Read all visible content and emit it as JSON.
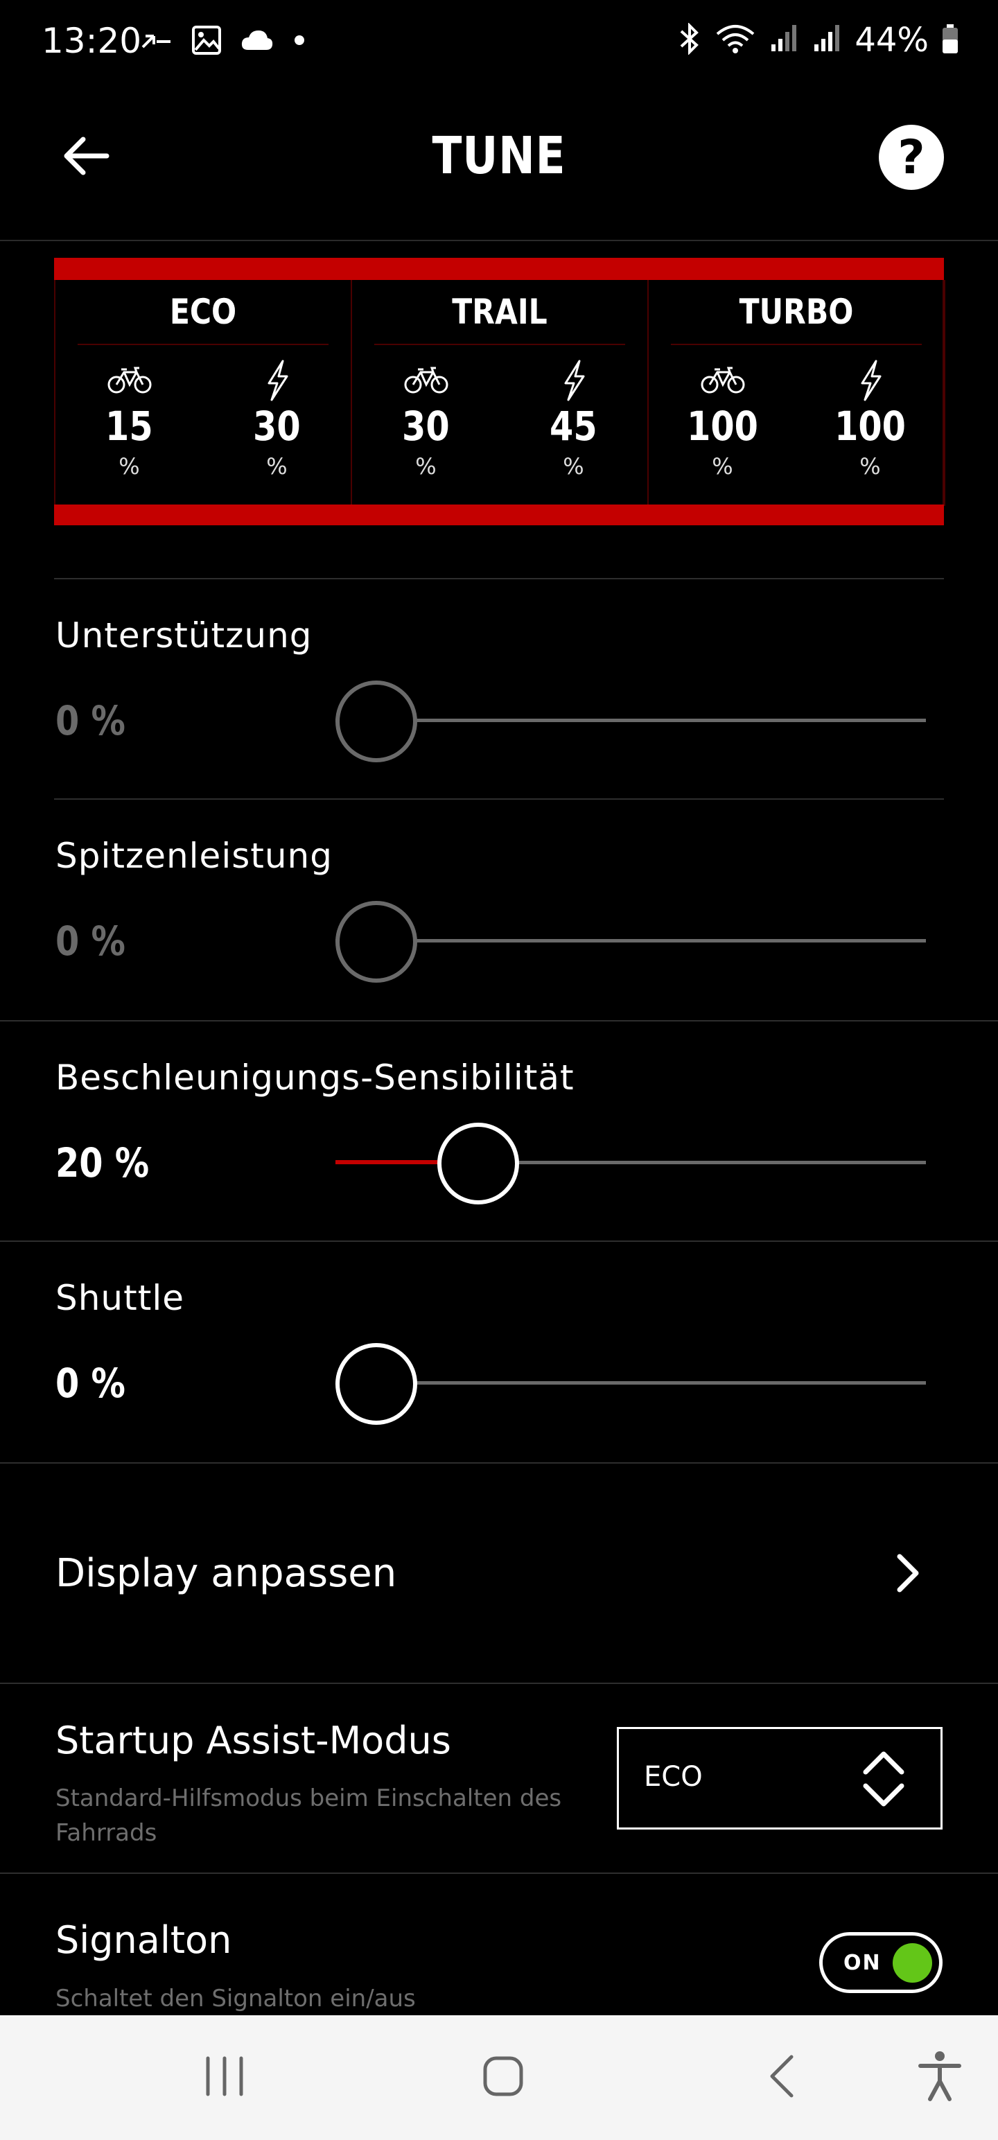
{
  "status_bar": {
    "time": "13:20",
    "battery": "44%",
    "icons_left": [
      "missed-call-icon",
      "gallery-icon",
      "cloud-icon",
      "dot-icon"
    ],
    "icons_right": [
      "bluetooth-icon",
      "wifi-icon",
      "signal-icon",
      "signal-icon",
      "battery-icon"
    ]
  },
  "header": {
    "title": "TUNE",
    "back_icon": "arrow-left-icon",
    "help_label": "?"
  },
  "modes": [
    {
      "name": "ECO",
      "assist": "15",
      "peak": "30",
      "unit": "%"
    },
    {
      "name": "TRAIL",
      "assist": "30",
      "peak": "45",
      "unit": "%"
    },
    {
      "name": "TURBO",
      "assist": "100",
      "peak": "100",
      "unit": "%"
    }
  ],
  "sliders": [
    {
      "label": "Unterstützung",
      "value": "0 %",
      "percent": 0,
      "enabled": false
    },
    {
      "label": "Spitzenleistung",
      "value": "0 %",
      "percent": 0,
      "enabled": false
    },
    {
      "label": "Beschleunigungs-Sensibilität",
      "value": "20 %",
      "percent": 20,
      "enabled": true
    },
    {
      "label": "Shuttle",
      "value": "0 %",
      "percent": 0,
      "enabled": true
    }
  ],
  "display_row": {
    "label": "Display anpassen"
  },
  "startup": {
    "label": "Startup Assist-Modus",
    "description": "Standard-Hilfsmodus beim Einschalten des Fahrrads",
    "selected": "ECO"
  },
  "signal": {
    "label": "Signalton",
    "description": "Schaltet den Signalton ein/aus",
    "toggle_text": "ON",
    "on": true
  },
  "colors": {
    "accent_red": "#c40000",
    "toggle_green": "#63c618",
    "dim_gray": "#6a6a6a"
  }
}
